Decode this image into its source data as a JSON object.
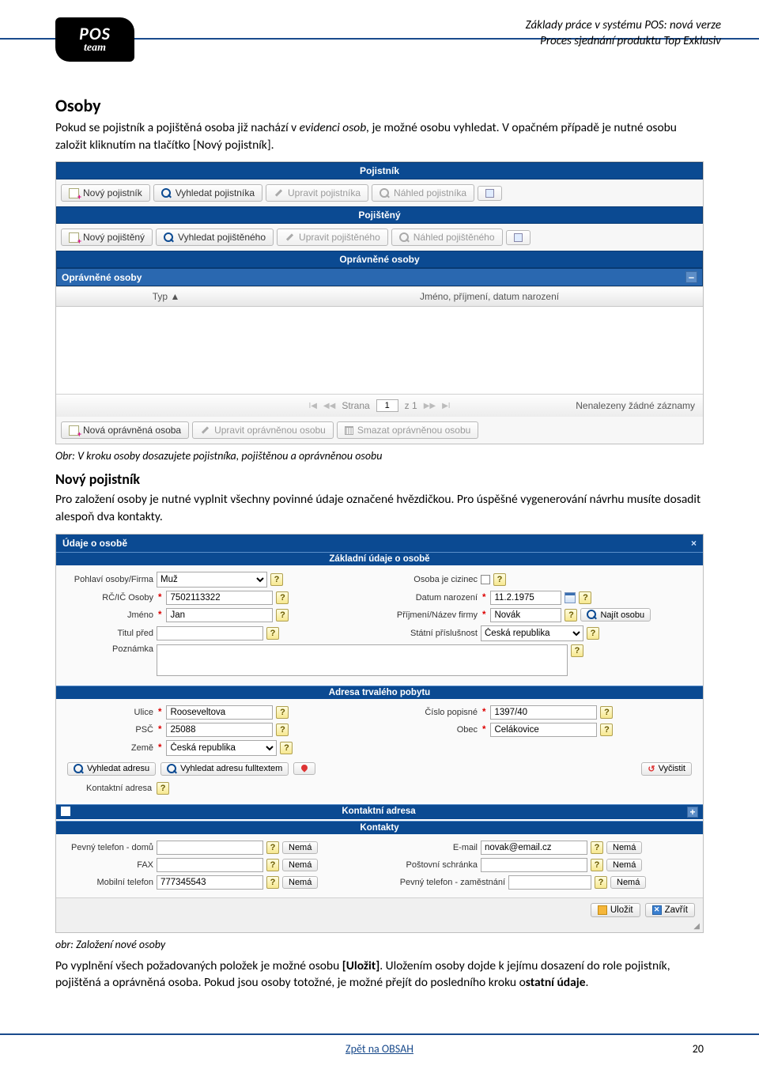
{
  "header": {
    "line1": "Základy práce v systému POS: nová verze",
    "line2": "Proces sjednání produktu Top Exklusiv",
    "logo_line1": "POS",
    "logo_line2": "team"
  },
  "sec1": {
    "title": "Osoby",
    "para_before": "Pokud se pojistník a pojištěná osoba již nachází v ",
    "para_em": "evidenci osob,",
    "para_after": " je možné osobu vyhledat. V opačném případě je nutné osobu založit kliknutím na tlačítko [Nový pojistník]."
  },
  "shot1": {
    "bar1": "Pojistník",
    "tb1": {
      "b1": "Nový pojistník",
      "b2": "Vyhledat pojistníka",
      "b3": "Upravit pojistníka",
      "b4": "Náhled pojistníka"
    },
    "bar2": "Pojištěný",
    "tb2": {
      "b1": "Nový pojištěný",
      "b2": "Vyhledat pojištěného",
      "b3": "Upravit pojištěného",
      "b4": "Náhled pojištěného"
    },
    "bar3": "Oprávněné osoby",
    "panel_title": "Oprávněné osoby",
    "minus": "–",
    "colA": "Typ ▲",
    "colB": "Jméno, příjmení, datum narození",
    "pager": {
      "label_strana": "Strana",
      "page": "1",
      "label_z": "z 1",
      "empty": "Nenalezeny žádné záznamy"
    },
    "tb3": {
      "b1": "Nová oprávněná osoba",
      "b2": "Upravit oprávněnou osobu",
      "b3": "Smazat oprávněnou osobu"
    }
  },
  "caption1": "Obr: V kroku osoby dosazujete pojistníka, pojištěnou a oprávněnou osobu",
  "sec2": {
    "title": "Nový pojistník",
    "para": "Pro založení osoby je nutné vyplnit všechny povinné údaje označené hvězdičkou. Pro úspěšné vygenerování návrhu musíte dosadit alespoň dva kontakty."
  },
  "shot2": {
    "title": "Údaje o osobě",
    "close": "×",
    "sub1": "Základní údaje o osobě",
    "basic": {
      "lbl_pohlavi": "Pohlaví osoby/Firma",
      "val_pohlavi": "Muž",
      "lbl_cizinec": "Osoba je cizinec",
      "lbl_rc": "RČ/IČ Osoby",
      "val_rc": "7502113322",
      "lbl_datum": "Datum narození",
      "val_datum": "11.2.1975",
      "lbl_jmeno": "Jméno",
      "val_jmeno": "Jan",
      "lbl_prijmeni": "Příjmení/Název firmy",
      "val_prijmeni": "Novák",
      "btn_najit": "Najít osobu",
      "lbl_titul": "Titul před",
      "lbl_prislusnost": "Státní příslušnost",
      "val_prislusnost": "Česká republika",
      "lbl_poznamka": "Poznámka"
    },
    "sub2": "Adresa trvalého pobytu",
    "addr": {
      "lbl_ulice": "Ulice",
      "val_ulice": "Rooseveltova",
      "lbl_cp": "Číslo popisné",
      "val_cp": "1397/40",
      "lbl_psc": "PSČ",
      "val_psc": "25088",
      "lbl_obec": "Obec",
      "val_obec": "Čelákovice",
      "lbl_zeme": "Země",
      "val_zeme": "Česká republika",
      "btn_vyhledat": "Vyhledat adresu",
      "btn_fulltext": "Vyhledat adresu fulltextem",
      "btn_vycistit": "Vyčistit",
      "lbl_kontaktni": "Kontaktní adresa"
    },
    "sub3": "Kontaktní adresa",
    "sub4": "Kontakty",
    "contacts": {
      "lbl_pevny": "Pevný telefon - domů",
      "lbl_email": "E-mail",
      "val_email": "novak@email.cz",
      "lbl_fax": "FAX",
      "lbl_schranka": "Poštovní schránka",
      "lbl_mobil": "Mobilní telefon",
      "val_mobil": "777345543",
      "lbl_zam": "Pevný telefon - zaměstnání",
      "btn_nema": "Nemá"
    },
    "footer": {
      "save": "Uložit",
      "close": "Zavřít"
    }
  },
  "caption2": "obr: Založení nové osoby",
  "para3_before": "Po vyplnění všech požadovaných položek je možné osobu ",
  "para3_bold1": "[Uložit]",
  "para3_mid": ". Uložením osoby dojde k jejímu dosazení do role pojistník, pojištěná a oprávněná osoba. Pokud jsou osoby totožné, je možné přejít do posledního kroku o",
  "para3_bold2": "statní údaje",
  "para3_after": ".",
  "footer_link": "Zpět na OBSAH",
  "pagenum": "20"
}
